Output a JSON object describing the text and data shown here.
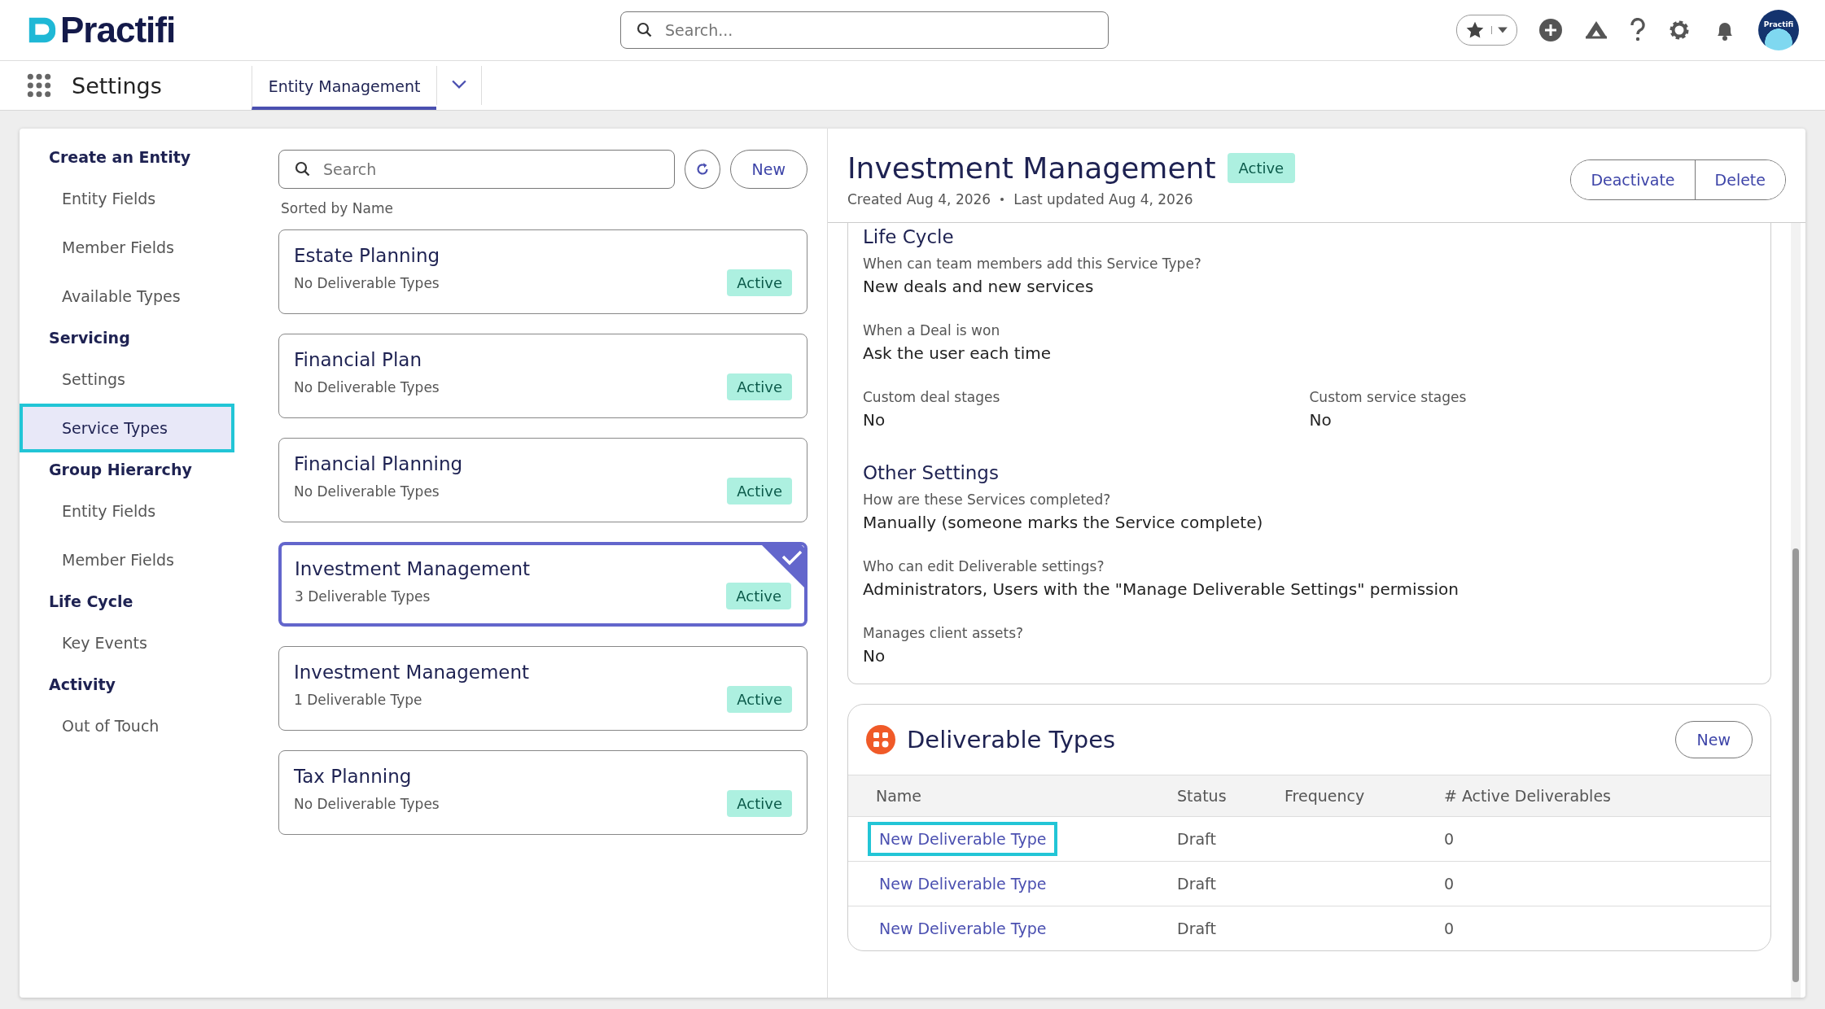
{
  "header": {
    "logo": "Practifi",
    "search": {
      "placeholder": "Search..."
    },
    "avatar_label": "Practifi"
  },
  "nav": {
    "title": "Settings",
    "tabs": [
      {
        "label": "Entity Management",
        "selected": true
      }
    ]
  },
  "sidebar": {
    "sections": [
      {
        "title": "Create an Entity",
        "items": [
          {
            "label": "Entity Fields",
            "selected": false
          },
          {
            "label": "Member Fields",
            "selected": false
          },
          {
            "label": "Available Types",
            "selected": false
          }
        ]
      },
      {
        "title": "Servicing",
        "items": [
          {
            "label": "Settings",
            "selected": false
          },
          {
            "label": "Service Types",
            "selected": true
          }
        ]
      },
      {
        "title": "Group Hierarchy",
        "items": [
          {
            "label": "Entity Fields",
            "selected": false
          },
          {
            "label": "Member Fields",
            "selected": false
          }
        ]
      },
      {
        "title": "Life Cycle",
        "items": [
          {
            "label": "Key Events",
            "selected": false
          }
        ]
      },
      {
        "title": "Activity",
        "items": [
          {
            "label": "Out of Touch",
            "selected": false
          }
        ]
      }
    ]
  },
  "list": {
    "search": {
      "placeholder": "Search"
    },
    "new_button": "New",
    "sort_label": "Sorted by Name",
    "cards": [
      {
        "title": "Estate Planning",
        "subtitle": "No Deliverable Types",
        "status": "Active",
        "selected": false
      },
      {
        "title": "Financial Plan",
        "subtitle": "No Deliverable Types",
        "status": "Active",
        "selected": false
      },
      {
        "title": "Financial Planning",
        "subtitle": "No Deliverable Types",
        "status": "Active",
        "selected": false
      },
      {
        "title": "Investment Management",
        "subtitle": "3 Deliverable Types",
        "status": "Active",
        "selected": true
      },
      {
        "title": "Investment Management",
        "subtitle": "1 Deliverable Type",
        "status": "Active",
        "selected": false
      },
      {
        "title": "Tax Planning",
        "subtitle": "No Deliverable Types",
        "status": "Active",
        "selected": false
      }
    ]
  },
  "detail": {
    "title": "Investment Management",
    "status": "Active",
    "created": "Created Aug 4, 2026",
    "updated": "Last updated Aug 4, 2026",
    "buttons": [
      "Deactivate",
      "Delete"
    ],
    "sections": [
      {
        "heading": "Life Cycle",
        "rows": [
          [
            {
              "label": "When can team members add this Service Type?",
              "value": "New deals and new services"
            }
          ],
          [
            {
              "label": "When a Deal is won",
              "value": "Ask the user each time"
            }
          ],
          [
            {
              "label": "Custom deal stages",
              "value": "No"
            },
            {
              "label": "Custom service stages",
              "value": "No"
            }
          ]
        ]
      },
      {
        "heading": "Other Settings",
        "rows": [
          [
            {
              "label": "How are these Services completed?",
              "value": "Manually (someone marks the Service complete)"
            }
          ],
          [
            {
              "label": "Who can edit Deliverable settings?",
              "value": "Administrators, Users with the \"Manage Deliverable Settings\" permission"
            }
          ],
          [
            {
              "label": "Manages client assets?",
              "value": "No"
            }
          ]
        ]
      }
    ],
    "deliverables": {
      "title": "Deliverable Types",
      "new_button": "New",
      "columns": [
        "Name",
        "Status",
        "Frequency",
        "# Active Deliverables"
      ],
      "rows": [
        {
          "name": "New Deliverable Type",
          "status": "Draft",
          "count": "0",
          "focused": true
        },
        {
          "name": "New Deliverable Type",
          "status": "Draft",
          "count": "0",
          "focused": false
        },
        {
          "name": "New Deliverable Type",
          "status": "Draft",
          "count": "0",
          "focused": false
        }
      ]
    }
  }
}
